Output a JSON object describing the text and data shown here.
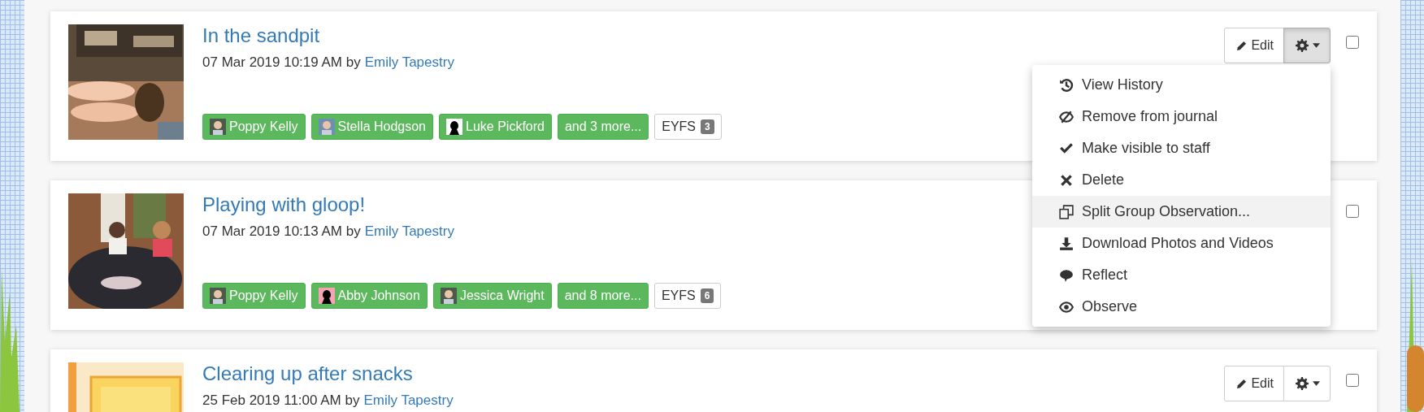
{
  "observations": [
    {
      "title": "In the sandpit",
      "meta": "07 Mar 2019 10:19 AM by",
      "author": "Emily Tapestry",
      "children": [
        {
          "name": "Poppy Kelly"
        },
        {
          "name": "Stella Hodgson"
        },
        {
          "name": "Luke Pickford",
          "kind": "silhouette"
        }
      ],
      "more": "and 3 more...",
      "framework": {
        "label": "EYFS",
        "count": "3"
      },
      "actions": {
        "edit": "Edit",
        "menu_open": true
      },
      "checked": false
    },
    {
      "title": "Playing with gloop!",
      "meta": "07 Mar 2019 10:13 AM by",
      "author": "Emily Tapestry",
      "children": [
        {
          "name": "Poppy Kelly"
        },
        {
          "name": "Abby Johnson",
          "kind": "silhouette"
        },
        {
          "name": "Jessica Wright"
        }
      ],
      "more": "and 8 more...",
      "framework": {
        "label": "EYFS",
        "count": "6"
      },
      "checked": false
    },
    {
      "title": "Clearing up after snacks",
      "meta": "25 Feb 2019 11:00 AM by",
      "author": "Emily Tapestry",
      "actions": {
        "edit": "Edit",
        "menu_open": false
      },
      "checked": false
    }
  ],
  "menu": {
    "items": [
      {
        "label": "View History",
        "selected": false
      },
      {
        "label": "Remove from journal",
        "selected": false
      },
      {
        "label": "Make visible to staff",
        "selected": false
      },
      {
        "label": "Delete",
        "selected": false
      },
      {
        "label": "Split Group Observation...",
        "selected": true
      },
      {
        "label": "Download Photos and Videos",
        "selected": false
      },
      {
        "label": "Reflect",
        "selected": false
      },
      {
        "label": "Observe",
        "selected": false
      }
    ]
  }
}
